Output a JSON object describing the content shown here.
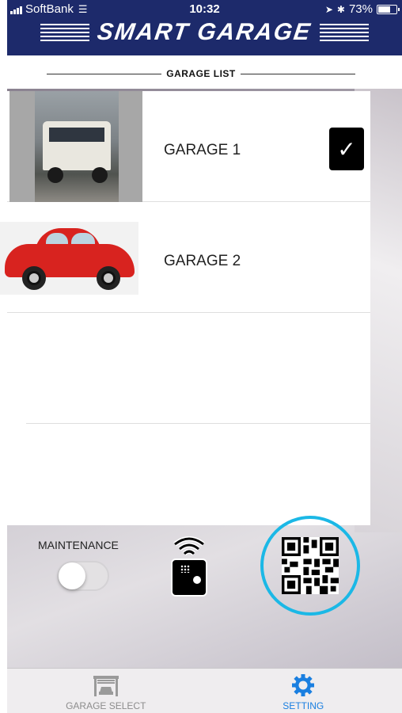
{
  "status_bar": {
    "carrier": "SoftBank",
    "time": "10:32",
    "battery": "73%",
    "battery_level": 0.73
  },
  "header": {
    "title": "SMART GARAGE"
  },
  "section_title": "GARAGE LIST",
  "garages": [
    {
      "name": "GARAGE 1",
      "selected": true
    },
    {
      "name": "GARAGE 2",
      "selected": false
    }
  ],
  "controls": {
    "maintenance_label": "MAINTENANCE",
    "maintenance_on": false
  },
  "tabs": [
    {
      "label": "GARAGE SELECT",
      "active": false
    },
    {
      "label": "SETTING",
      "active": true
    }
  ],
  "colors": {
    "header_bg": "#1d2a6b",
    "accent_blue": "#1a7fe0",
    "qr_ring": "#1bb8e6"
  }
}
